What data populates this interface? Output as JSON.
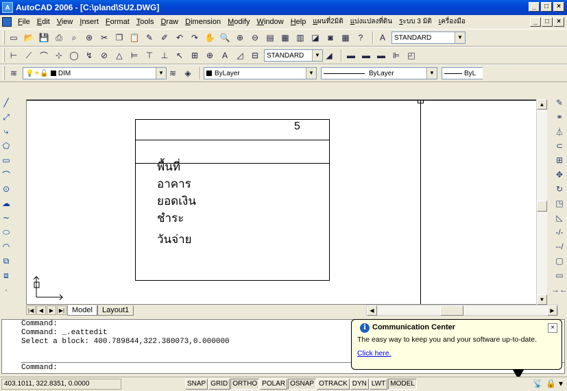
{
  "window": {
    "title": "AutoCAD 2006 - [C:\\pland\\SU2.DWG]",
    "app_icon": "autocad-icon",
    "buttons": [
      "_",
      "□",
      "×"
    ]
  },
  "menubar": {
    "items": [
      "File",
      "Edit",
      "View",
      "Insert",
      "Format",
      "Tools",
      "Draw",
      "Dimension",
      "Modify",
      "Window",
      "Help",
      "แผนที่2มิติ",
      "แบ่งแปลงที่ดิน",
      "ระบบ 3 มิติ",
      "เครื่องมือ"
    ],
    "mdi_buttons": [
      "_",
      "□",
      "×"
    ]
  },
  "toolbars": {
    "standard": {
      "text_style_combo": "STANDARD"
    },
    "dimension": {
      "dim_style_combo": "STANDARD"
    },
    "layers": {
      "layer_combo": "DIM",
      "color_combo": "ByLayer",
      "linetype_combo": "ByLayer",
      "lineweight_combo": "ByL"
    }
  },
  "drawing": {
    "block_number": "5",
    "text_rows": [
      "พื้นที่",
      "อาคาร",
      "ยอดเงิน",
      "ชำระ",
      "วันจ่าย"
    ]
  },
  "tabs": {
    "nav": [
      "|◀",
      "◀",
      "▶",
      "▶|"
    ],
    "items": [
      "Model",
      "Layout1"
    ]
  },
  "command": {
    "lines": [
      "Command:",
      "Command: _.eattedit",
      "Select a block: 400.789844,322.380073,0.000000"
    ],
    "prompt": "Command:"
  },
  "balloon": {
    "title": "Communication Center",
    "message": "The easy way to keep you and your software up-to-date.",
    "link": "Click here."
  },
  "statusbar": {
    "coords": "403.1011, 322.8351, 0.0000",
    "toggles": [
      {
        "label": "SNAP",
        "on": false
      },
      {
        "label": "GRID",
        "on": false
      },
      {
        "label": "ORTHO",
        "on": true
      },
      {
        "label": "POLAR",
        "on": false
      },
      {
        "label": "OSNAP",
        "on": true
      },
      {
        "label": "OTRACK",
        "on": false
      },
      {
        "label": "DYN",
        "on": false
      },
      {
        "label": "LWT",
        "on": false
      },
      {
        "label": "MODEL",
        "on": true
      }
    ]
  }
}
